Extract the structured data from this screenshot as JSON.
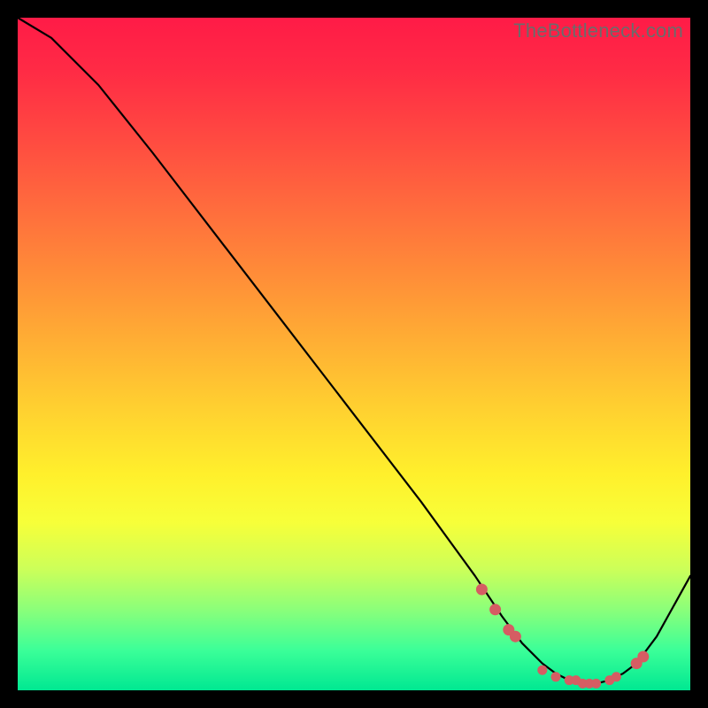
{
  "watermark": "TheBottleneck.com",
  "colors": {
    "background": "#000000",
    "gradient_top": "#ff1b47",
    "gradient_bottom": "#00e892",
    "curve": "#000000",
    "markers": "#d55d63"
  },
  "chart_data": {
    "type": "line",
    "title": "",
    "xlabel": "",
    "ylabel": "",
    "xlim": [
      0,
      100
    ],
    "ylim": [
      0,
      100
    ],
    "series": [
      {
        "name": "curve",
        "x": [
          0,
          5,
          12,
          20,
          30,
          40,
          50,
          60,
          68,
          72,
          75,
          78,
          80,
          82,
          84,
          86,
          88,
          90,
          92,
          95,
          100
        ],
        "y": [
          100,
          97,
          90,
          80,
          67,
          54,
          41,
          28,
          17,
          11,
          7,
          4,
          2.5,
          1.5,
          1,
          1,
          1.5,
          2.5,
          4,
          8,
          17
        ]
      }
    ],
    "markers": {
      "name": "highlight-points",
      "x": [
        69,
        71,
        73,
        74,
        78,
        80,
        82,
        83,
        84,
        85,
        86,
        88,
        89,
        92,
        93
      ],
      "y": [
        15,
        12,
        9,
        8,
        3,
        2,
        1.5,
        1.5,
        1,
        1,
        1,
        1.5,
        2,
        4,
        5
      ],
      "r": [
        6,
        6,
        6,
        6,
        5,
        5,
        5,
        5,
        5,
        5,
        5,
        5,
        5,
        6,
        6
      ]
    }
  }
}
